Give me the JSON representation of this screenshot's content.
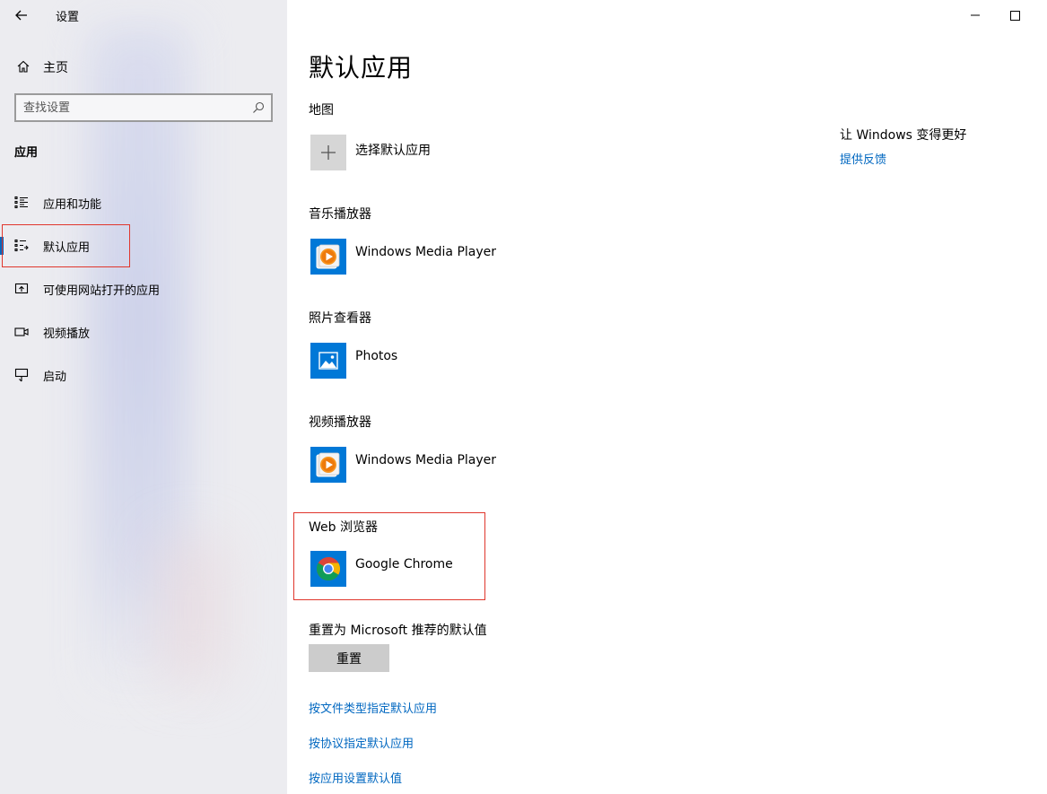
{
  "window": {
    "title": "设置"
  },
  "sidebar": {
    "home_label": "主页",
    "search_placeholder": "查找设置",
    "section_label": "应用",
    "items": [
      {
        "label": "应用和功能",
        "icon": "apps-features-icon"
      },
      {
        "label": "默认应用",
        "icon": "default-apps-icon",
        "selected": true
      },
      {
        "label": "可使用网站打开的应用",
        "icon": "apps-for-websites-icon"
      },
      {
        "label": "视频播放",
        "icon": "video-playback-icon"
      },
      {
        "label": "启动",
        "icon": "startup-icon"
      }
    ]
  },
  "main": {
    "title": "默认应用",
    "categories": [
      {
        "label": "地图",
        "app": "选择默认应用",
        "icon": "plus-icon"
      },
      {
        "label": "音乐播放器",
        "app": "Windows Media Player",
        "icon": "windows-media-player-icon"
      },
      {
        "label": "照片查看器",
        "app": "Photos",
        "icon": "photos-icon"
      },
      {
        "label": "视频播放器",
        "app": "Windows Media Player",
        "icon": "windows-media-player-icon"
      },
      {
        "label": "Web 浏览器",
        "app": "Google Chrome",
        "icon": "chrome-icon"
      }
    ],
    "reset": {
      "label": "重置为 Microsoft 推荐的默认值",
      "button": "重置"
    },
    "links": [
      "按文件类型指定默认应用",
      "按协议指定默认应用",
      "按应用设置默认值"
    ]
  },
  "aside": {
    "heading": "让 Windows 变得更好",
    "link": "提供反馈"
  },
  "colors": {
    "accent": "#0067c0",
    "tile_blue": "#0078d7",
    "highlight_red": "#e0362c",
    "sidebar_bg": "#ececf0"
  }
}
